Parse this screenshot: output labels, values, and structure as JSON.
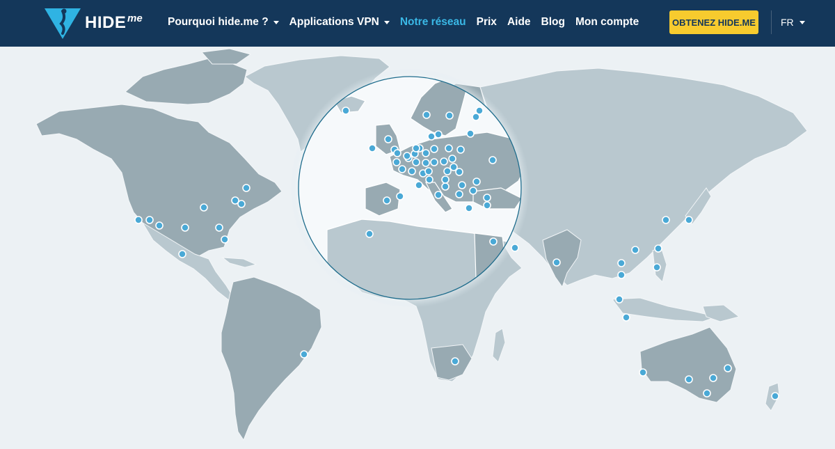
{
  "brand": {
    "name": "HIDE",
    "suffix": "me"
  },
  "nav": {
    "items": [
      {
        "label": "Pourquoi hide.me ?",
        "dropdown": true,
        "active": false
      },
      {
        "label": "Applications VPN",
        "dropdown": true,
        "active": false
      },
      {
        "label": "Notre réseau",
        "dropdown": false,
        "active": true
      },
      {
        "label": "Prix",
        "dropdown": false,
        "active": false
      },
      {
        "label": "Aide",
        "dropdown": false,
        "active": false
      },
      {
        "label": "Blog",
        "dropdown": false,
        "active": false
      },
      {
        "label": "Mon compte",
        "dropdown": false,
        "active": false
      }
    ]
  },
  "cta": {
    "label": "OBTENEZ HIDE.ME"
  },
  "language": {
    "label": "FR"
  },
  "colors": {
    "navbar": "#14375a",
    "accent": "#3ab8e6",
    "cta": "#f7cb2e",
    "ocean": "#ecf1f4",
    "land_light": "#b9c8cf",
    "land_dark": "#98aab2",
    "server_dot": "#4aa9d6"
  },
  "map": {
    "magnifier_region": "Europe",
    "server_count": 81
  }
}
